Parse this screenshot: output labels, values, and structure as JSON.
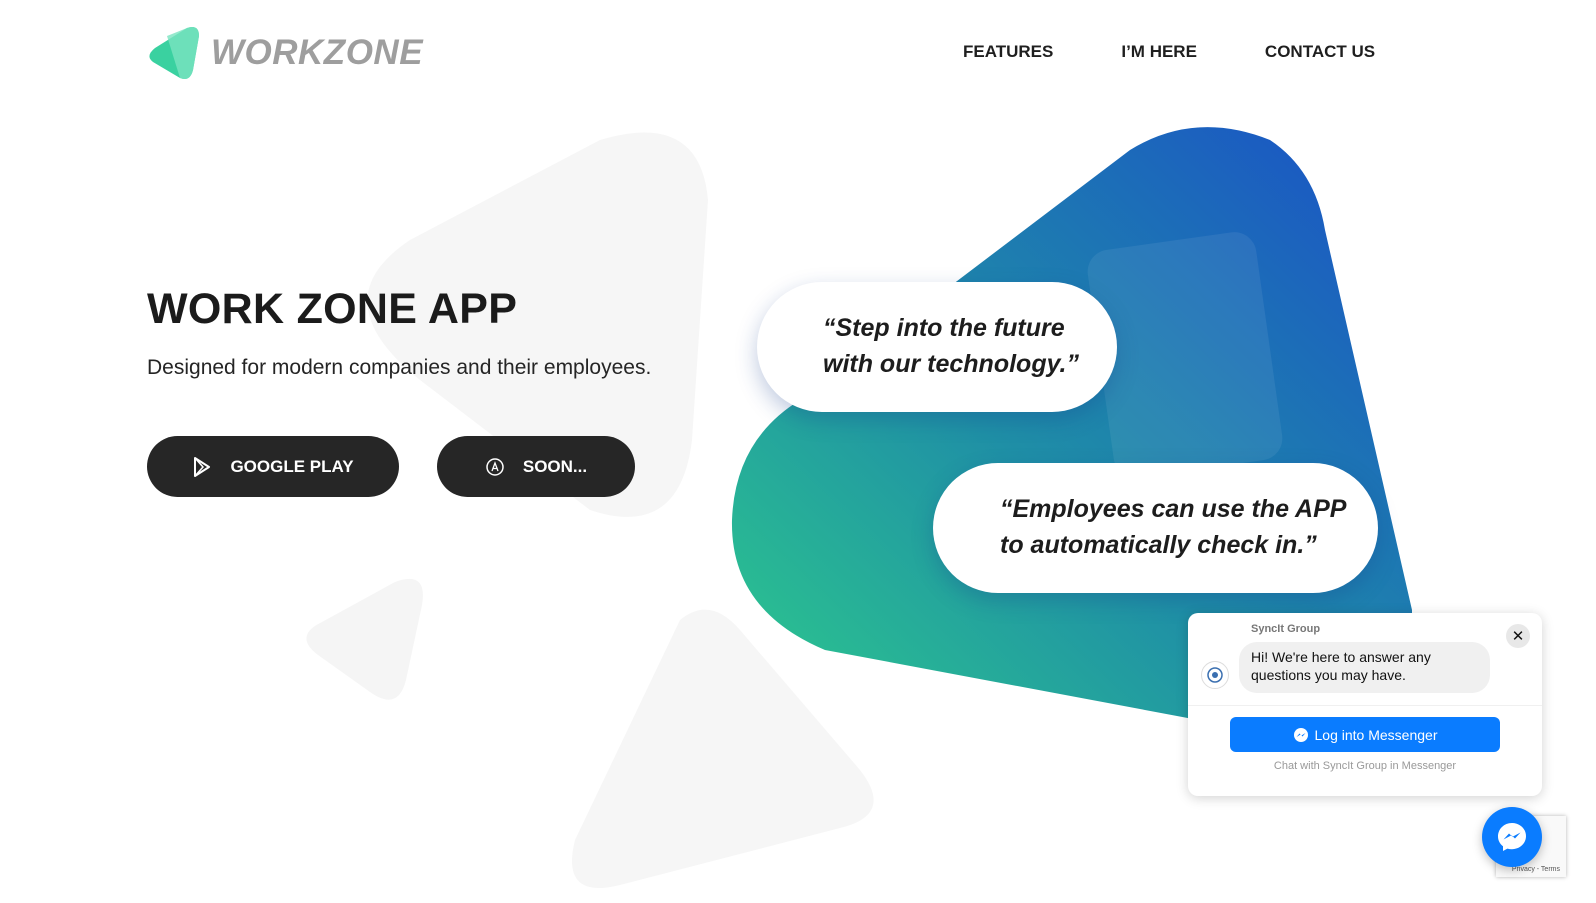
{
  "brand": {
    "name": "WORKZONE",
    "accent_green": "#3ad1a0",
    "accent_blue": "#1a5cc8"
  },
  "nav": {
    "items": [
      {
        "label": "FEATURES"
      },
      {
        "label": "I’M HERE"
      },
      {
        "label": "CONTACT US"
      }
    ]
  },
  "hero": {
    "title": "WORK ZONE APP",
    "subtitle": "Designed for modern companies and their employees.",
    "buttons": [
      {
        "label": "GOOGLE PLAY",
        "icon": "google-play-icon"
      },
      {
        "label": "SOON...",
        "icon": "app-store-icon"
      }
    ]
  },
  "quotes": [
    {
      "line1": "“Step into the future",
      "line2": "with our technology.”"
    },
    {
      "line1": "“Employees can use the APP",
      "line2": "to automatically check in.”"
    }
  ],
  "chat_widget": {
    "page_name": "SyncIt Group",
    "greeting_line1": "Hi! We're here to answer any",
    "greeting_line2": "questions you may have.",
    "login_label": "Log into Messenger",
    "footer": "Chat with SyncIt Group in Messenger",
    "close_label": "✕"
  },
  "recaptcha": {
    "text": "Privacy - Terms"
  }
}
